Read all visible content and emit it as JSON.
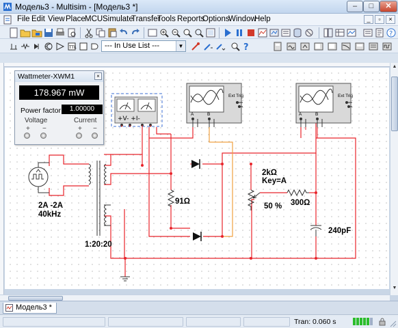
{
  "window": {
    "title": "Модель3 - Multisim - [Модель3 *]",
    "buttons": {
      "minimize": "–",
      "maximize": "□",
      "close": "✕"
    }
  },
  "menubar": {
    "items": [
      "File",
      "Edit",
      "View",
      "Place",
      "MCU",
      "Simulate",
      "Transfer",
      "Tools",
      "Reports",
      "Options",
      "Window",
      "Help"
    ]
  },
  "toolbar": {
    "in_use_list": "--- In Use List ---"
  },
  "wattmeter": {
    "title": "Wattmeter-XWM1",
    "reading": "178.967 mW",
    "power_factor_label": "Power factor:",
    "power_factor_value": "1.00000",
    "voltage_label": "Voltage",
    "current_label": "Current",
    "plus": "+",
    "minus": "−"
  },
  "circuit": {
    "source_amplitude": "2A -2A",
    "source_freq": "40kHz",
    "transformer_ratio": "1:20:20",
    "resistor_91": "91Ω",
    "pot_value": "2kΩ",
    "pot_key": "Key=A",
    "pot_percent": "50 %",
    "resistor_300": "300Ω",
    "capacitor": "240pF",
    "scope_ext_trig": "Ext Trig",
    "scope_a": "A",
    "scope_b": "B",
    "wattmeter_terms": "+V− +I−"
  },
  "tabs": {
    "active": "Модель3 *"
  },
  "status": {
    "tran": "Tran: 0.060 s"
  },
  "colors": {
    "wire_red": "#e8232a",
    "wire_orange": "#f0a040",
    "selection_blue": "#3c6fd6"
  }
}
